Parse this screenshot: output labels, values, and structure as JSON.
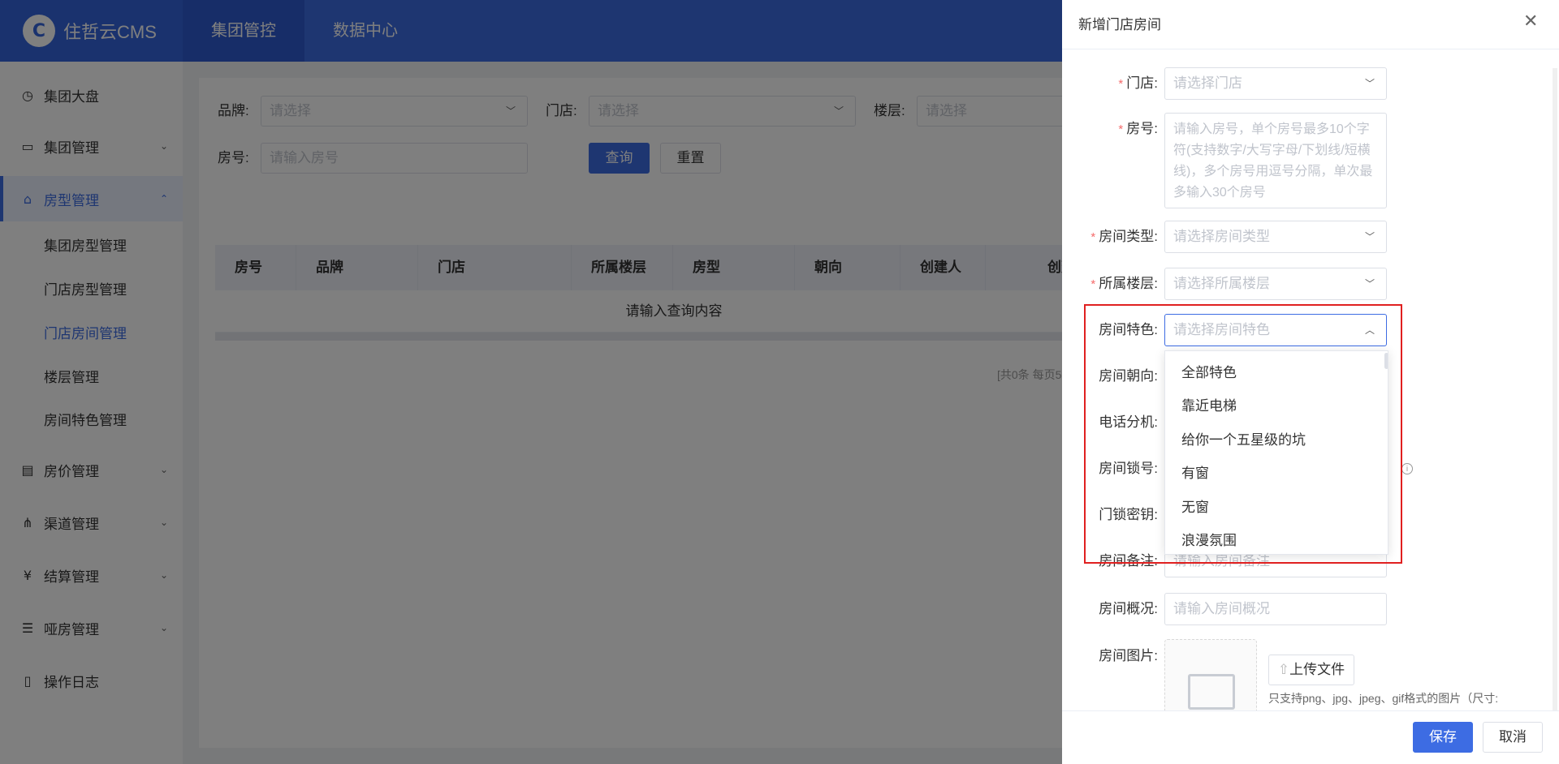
{
  "header": {
    "logo_text": "住哲云CMS",
    "tabs": [
      "集团管控",
      "数据中心"
    ]
  },
  "sidebar": {
    "items": [
      {
        "label": "集团大盘",
        "icon": "dashboard-icon"
      },
      {
        "label": "集团管理",
        "icon": "monitor-icon"
      },
      {
        "label": "房型管理",
        "icon": "home-icon"
      },
      {
        "label": "房价管理",
        "icon": "price-icon"
      },
      {
        "label": "渠道管理",
        "icon": "channel-icon"
      },
      {
        "label": "结算管理",
        "icon": "yen-icon"
      },
      {
        "label": "哑房管理",
        "icon": "list-icon"
      },
      {
        "label": "操作日志",
        "icon": "document-icon"
      }
    ],
    "sub_items": [
      "集团房型管理",
      "门店房型管理",
      "门店房间管理",
      "楼层管理",
      "房间特色管理"
    ]
  },
  "filters": {
    "brand_label": "品牌:",
    "brand_placeholder": "请选择",
    "store_label": "门店:",
    "store_placeholder": "请选择",
    "floor_label": "楼层:",
    "floor_placeholder": "请选择",
    "room_label": "房号:",
    "room_placeholder": "请输入房号",
    "search_button": "查询",
    "reset_button": "重置"
  },
  "table": {
    "columns": [
      "房号",
      "品牌",
      "门店",
      "所属楼层",
      "房型",
      "朝向",
      "创建人",
      "创建"
    ],
    "empty_text": "请输入查询内容",
    "pager_text": "[共0条 每页5"
  },
  "drawer": {
    "title": "新增门店房间",
    "close_icon": "close-icon",
    "fields": {
      "store": {
        "label": "门店:",
        "placeholder": "请选择门店"
      },
      "room_no": {
        "label": "房号:",
        "placeholder": "请输入房号，单个房号最多10个字符(支持数字/大写字母/下划线/短横线)，多个房号用逗号分隔，单次最多输入30个房号"
      },
      "room_type": {
        "label": "房间类型:",
        "placeholder": "请选择房间类型"
      },
      "floor": {
        "label": "所属楼层:",
        "placeholder": "请选择所属楼层"
      },
      "feature": {
        "label": "房间特色:",
        "placeholder": "请选择房间特色"
      },
      "orientation": {
        "label": "房间朝向:"
      },
      "phone_ext": {
        "label": "电话分机:"
      },
      "lock_no": {
        "label": "房间锁号:"
      },
      "lock_key": {
        "label": "门锁密钥:"
      },
      "remark": {
        "label": "房间备注:",
        "placeholder": "请输入房间备注"
      },
      "overview": {
        "label": "房间概况:",
        "placeholder": "请输入房间概况"
      },
      "image": {
        "label": "房间图片:"
      }
    },
    "feature_options": [
      "全部特色",
      "靠近电梯",
      "给你一个五星级的坑",
      "有窗",
      "无窗",
      "浪漫氛围"
    ],
    "upload_button": "上传文件",
    "upload_tip": "只支持png、jpg、jpeg、gif格式的图片（尺寸:",
    "save_button": "保存",
    "cancel_button": "取消"
  },
  "colors": {
    "primary": "#3d6ce3",
    "highlight_border": "#e02020",
    "required": "#f56c6c"
  }
}
